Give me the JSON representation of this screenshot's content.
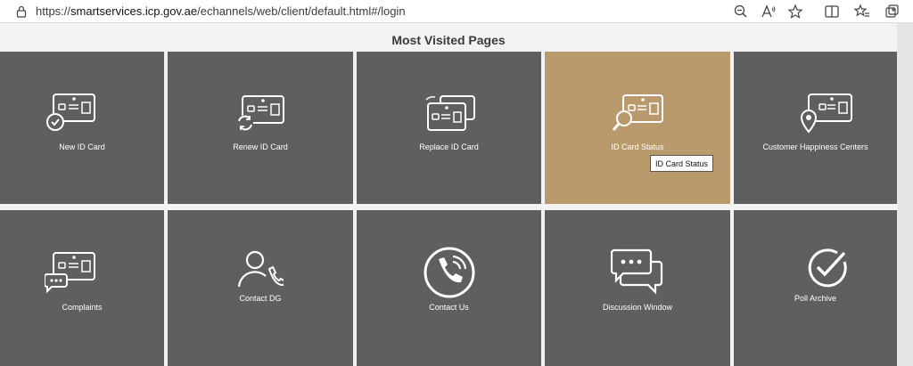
{
  "browser": {
    "url_prefix": "https://",
    "url_host": "smartservices.icp.gov.ae",
    "url_path": "/echannels/web/client/default.html#/login",
    "icons": [
      "lock-icon",
      "zoom-out-icon",
      "read-aloud-icon",
      "favorite-star-icon",
      "split-screen-icon",
      "favorites-icon",
      "collections-icon"
    ]
  },
  "section": {
    "title": "Most Visited Pages"
  },
  "tiles": [
    {
      "label": "New ID Card",
      "icon": "id-card-check-icon"
    },
    {
      "label": "Renew ID Card",
      "icon": "id-card-renew-icon"
    },
    {
      "label": "Replace ID Card",
      "icon": "id-card-replace-icon"
    },
    {
      "label": "ID Card Status",
      "icon": "id-card-search-icon"
    },
    {
      "label": "Customer Happiness Centers",
      "icon": "location-pin-card-icon"
    },
    {
      "label": "Complaints",
      "icon": "id-card-chat-icon"
    },
    {
      "label": "Contact DG",
      "icon": "person-phone-icon"
    },
    {
      "label": "Contact Us",
      "icon": "phone-circle-icon"
    },
    {
      "label": "Discussion Window",
      "icon": "chat-bubbles-icon"
    },
    {
      "label": "Poll Archive",
      "icon": "check-circle-icon"
    }
  ],
  "tooltip": {
    "text": "ID Card Status"
  },
  "colors": {
    "tile": "#5f5f61",
    "tile_active": "#b89a6c",
    "icon": "#ffffff"
  }
}
